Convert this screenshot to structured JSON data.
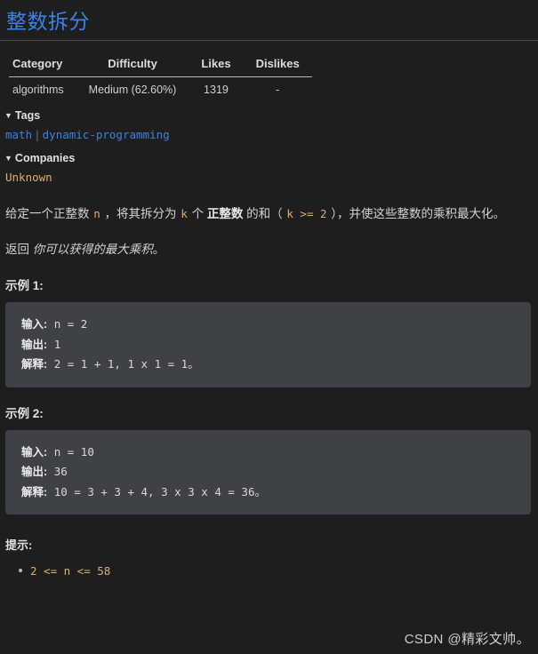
{
  "problem": {
    "title": "整数拆分"
  },
  "meta_table": {
    "headers": [
      "Category",
      "Difficulty",
      "Likes",
      "Dislikes"
    ],
    "row": [
      "algorithms",
      "Medium (62.60%)",
      "1319",
      "-"
    ]
  },
  "tags_section": {
    "heading": "Tags",
    "caret": "▼",
    "items": [
      "math",
      "dynamic-programming"
    ],
    "separator": "|"
  },
  "companies_section": {
    "heading": "Companies",
    "caret": "▼",
    "value": "Unknown"
  },
  "description": {
    "p1_a": "给定一个正整数 ",
    "p1_code_n": "n",
    "p1_b": " ，将其拆分为 ",
    "p1_code_k": "k",
    "p1_c": " 个 ",
    "p1_bold": "正整数",
    "p1_d": " 的和（ ",
    "p1_code_k2": "k >= 2",
    "p1_e": " ），并使这些整数的乘积最大化。",
    "p2_a": "返回 ",
    "p2_italic": "你可以获得的最大乘积",
    "p2_b": "。"
  },
  "examples": [
    {
      "title": "示例 1:",
      "input_label": "输入:",
      "input_value": " n = 2",
      "output_label": "输出:",
      "output_value": " 1",
      "explain_label": "解释:",
      "explain_value": " 2 = 1 + 1, 1 x 1 = 1。"
    },
    {
      "title": "示例 2:",
      "input_label": "输入:",
      "input_value": " n = 10",
      "output_label": "输出:",
      "output_value": " 36",
      "explain_label": "解释:",
      "explain_value": " 10 = 3 + 3 + 4, 3 x 3 x 4 = 36。"
    }
  ],
  "hints": {
    "title": "提示:",
    "items": [
      "2 <= n <= 58"
    ]
  },
  "watermark": {
    "text": "CSDN @精彩文帅。"
  },
  "colors": {
    "background": "#1e1e1e",
    "title_blue": "#3b82e8",
    "code_amber": "#d8b172",
    "codeblock_bg": "#3e4247",
    "text": "#d2d2d2"
  }
}
